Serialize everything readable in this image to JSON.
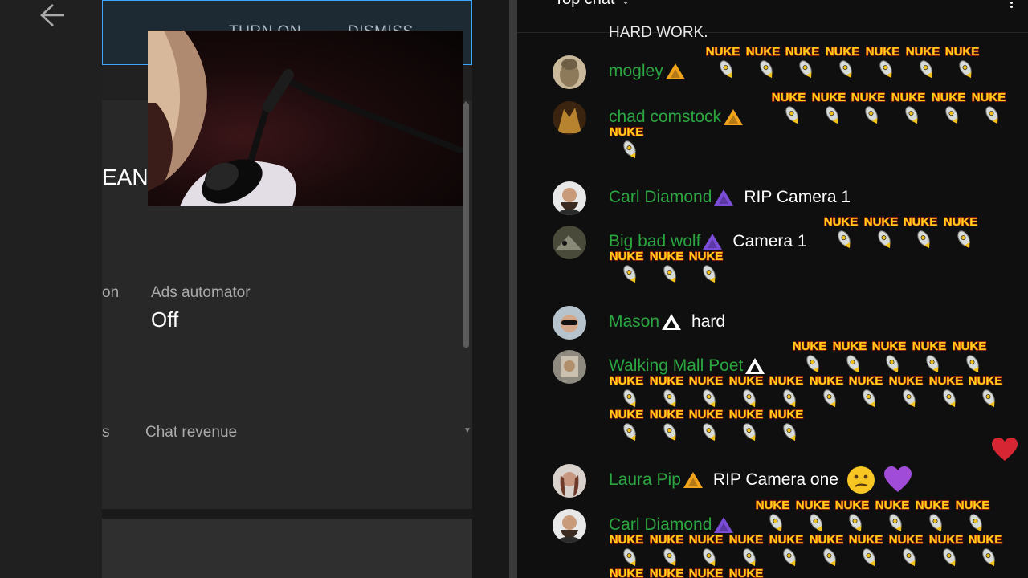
{
  "studio": {
    "topbar": {
      "turn_on": "TURN ON",
      "dismiss": "DISMISS"
    },
    "partial_title": "EANI",
    "partial_label_on": "on",
    "ads_automator": {
      "label": "Ads automator",
      "value": "Off"
    },
    "partial_label_s": "s",
    "chat_revenue": "Chat revenue"
  },
  "chat": {
    "header": "Top chat",
    "partial_message": "HARD WORK.",
    "emote_text": "NUKE",
    "messages": [
      {
        "author": "mogley",
        "badge": "gold",
        "text": "",
        "emotes": 7,
        "avatar": "buddha"
      },
      {
        "author": "chad comstock",
        "badge": "gold",
        "text": "",
        "emotes": 7,
        "avatar": "brown"
      },
      {
        "author": "Carl Diamond",
        "badge": "purple",
        "text": "RIP Camera 1",
        "emotes": 0,
        "avatar": "beard"
      },
      {
        "author": "Big bad wolf",
        "badge": "purple",
        "text": "Camera 1",
        "emotes": 7,
        "avatar": "wolf"
      },
      {
        "author": "Mason",
        "badge": "white",
        "text": "hard",
        "emotes": 0,
        "avatar": "glasses"
      },
      {
        "author": "Walking Mall Poet",
        "badge": "white",
        "text": "",
        "emotes": 20,
        "avatar": "poet"
      },
      {
        "author": "Laura Pip",
        "badge": "gold",
        "text": "RIP Camera one",
        "emotes": 0,
        "avatar": "laura"
      },
      {
        "author": "Carl Diamond",
        "badge": "purple",
        "text": "",
        "emotes": 20,
        "avatar": "beard"
      }
    ]
  },
  "colors": {
    "author_green": "#2ba640",
    "accent_blue": "#3ea6ff",
    "nuke_text": "#ffd21a",
    "nuke_outline": "#c2290f"
  }
}
